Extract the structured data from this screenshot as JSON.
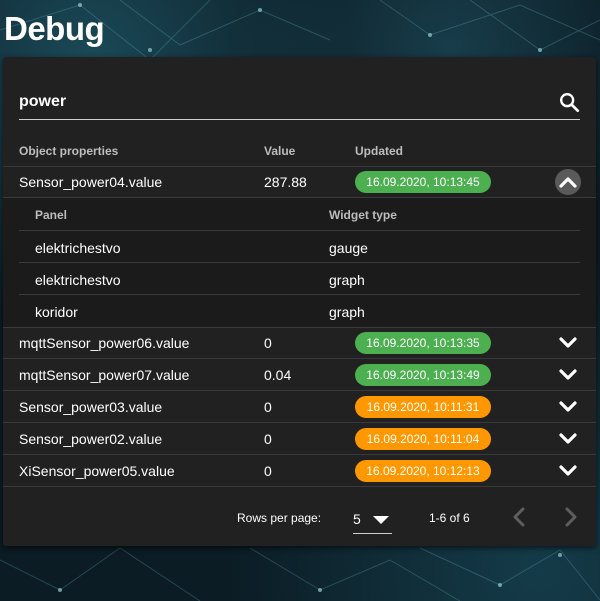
{
  "page": {
    "title": "Debug"
  },
  "search": {
    "value": "power"
  },
  "table": {
    "headers": {
      "property": "Object properties",
      "value": "Value",
      "updated": "Updated"
    },
    "rows": [
      {
        "property": "Sensor_power04.value",
        "value": "287.88",
        "updated": "16.09.2020, 10:13:45",
        "status": "green",
        "expanded": true
      },
      {
        "property": "mqttSensor_power06.value",
        "value": "0",
        "updated": "16.09.2020, 10:13:35",
        "status": "green",
        "expanded": false
      },
      {
        "property": "mqttSensor_power07.value",
        "value": "0.04",
        "updated": "16.09.2020, 10:13:49",
        "status": "green",
        "expanded": false
      },
      {
        "property": "Sensor_power03.value",
        "value": "0",
        "updated": "16.09.2020, 10:11:31",
        "status": "orange",
        "expanded": false
      },
      {
        "property": "Sensor_power02.value",
        "value": "0",
        "updated": "16.09.2020, 10:11:04",
        "status": "orange",
        "expanded": false
      },
      {
        "property": "XiSensor_power05.value",
        "value": "0",
        "updated": "16.09.2020, 10:12:13",
        "status": "orange",
        "expanded": false
      }
    ],
    "detail": {
      "headers": {
        "panel": "Panel",
        "widget": "Widget type"
      },
      "rows": [
        {
          "panel": "elektrichestvo",
          "widget": "gauge"
        },
        {
          "panel": "elektrichestvo",
          "widget": "graph"
        },
        {
          "panel": "koridor",
          "widget": "graph"
        }
      ]
    }
  },
  "pagination": {
    "rows_per_page_label": "Rows per page:",
    "rows_per_page": "5",
    "range": "1-6 of 6"
  },
  "colors": {
    "green": "#4caf50",
    "orange": "#ff9800",
    "card": "#212121"
  },
  "icons": {
    "search": "search-icon",
    "expand": "chevron-down-icon",
    "collapse": "chevron-up-icon",
    "prev": "chevron-left-icon",
    "next": "chevron-right-icon"
  }
}
